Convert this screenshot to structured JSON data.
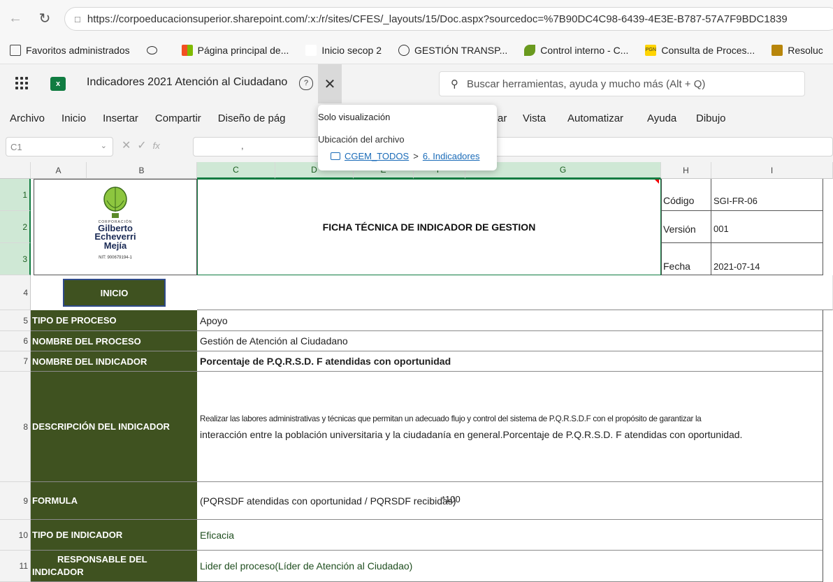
{
  "browser": {
    "url": "https://corpoeducacionsuperior.sharepoint.com/:x:/r/sites/CFES/_layouts/15/Doc.aspx?sourcedoc=%7B90DC4C98-6439-4E3E-B787-57A7F9BDC1839",
    "bookmarks": [
      {
        "label": "Favoritos administrados",
        "icon": "folder-icon"
      },
      {
        "label": "Página principal de...",
        "icon": "microsoft-icon"
      },
      {
        "label": "Inicio secop 2",
        "icon": "blank-page-icon"
      },
      {
        "label": "GESTIÓN TRANSP...",
        "icon": "globe-icon"
      },
      {
        "label": "Control interno - C...",
        "icon": "leaf-icon"
      },
      {
        "label": "Consulta de Proces...",
        "icon": "pgn-icon"
      },
      {
        "label": "Resoluc",
        "icon": "crest-icon"
      }
    ]
  },
  "excel": {
    "doc_title": "Indicadores 2021 Atención al Ciudadano",
    "search_placeholder": "Buscar herramientas, ayuda y mucho más (Alt + Q)",
    "ribbon_tabs": [
      "Archivo",
      "Inicio",
      "Insertar",
      "Compartir",
      "Diseño de pág",
      "ar",
      "Vista",
      "Automatizar",
      "Ayuda",
      "Dibujo"
    ],
    "name_box": "C1",
    "formula_value": ","
  },
  "popover": {
    "title": "Solo visualización",
    "location_label": "Ubicación del archivo",
    "path_root": "CGEM_TODOS",
    "path_sep": ">",
    "path_folder": "6. Indicadores"
  },
  "columns": [
    "A",
    "B",
    "C",
    "D",
    "E",
    "F",
    "G",
    "H",
    "I"
  ],
  "rows": [
    "1",
    "2",
    "3",
    "4",
    "5",
    "6",
    "7",
    "8",
    "9",
    "10",
    "11"
  ],
  "sheet": {
    "logo": {
      "line1": "CORPORACIÓN",
      "line2": "Gilberto",
      "line3": "Echeverri",
      "line4": "Mejía",
      "nit": "NIT: 900679194-1"
    },
    "header_title": "FICHA TÉCNICA DE INDICADOR DE  GESTION",
    "meta": [
      {
        "label": "Código",
        "value": "SGI-FR-06"
      },
      {
        "label": "Versión",
        "value": "001"
      },
      {
        "label": "Fecha",
        "value": "2021-07-14"
      }
    ],
    "inicio_button": "INICIO",
    "fields": [
      {
        "label": "TIPO DE PROCESO",
        "value": "Apoyo"
      },
      {
        "label": "NOMBRE DEL PROCESO",
        "value": "Gestión de Atención al Ciudadano"
      },
      {
        "label": "NOMBRE DEL INDICADOR",
        "value": "Porcentaje de P.Q.R.S.D. F atendidas con oportunidad"
      },
      {
        "label": "DESCRIPCIÓN  DEL INDICADOR",
        "value_line1": "Realizar las labores administrativas y técnicas que permitan un adecuado flujo y control del sistema de P.Q.R.S.D.F con el propósito de garantizar la",
        "value_line2": "interacción entre la población  universitaria y la ciudadanía en general.Porcentaje de P.Q.R.S.D. F atendidas con oportunidad."
      },
      {
        "label": "FORMULA",
        "value": "(PQRSDF atendidas con oportunidad / PQRSDF recibidas)",
        "overlay": "*100"
      },
      {
        "label": "TIPO DE INDICADOR",
        "value": "Eficacia"
      },
      {
        "label_line1": "RESPONSABLE  DEL",
        "label_line2": "INDICADOR",
        "value": "Lider del proceso(Líder de Atención al Ciudadao)"
      }
    ]
  }
}
